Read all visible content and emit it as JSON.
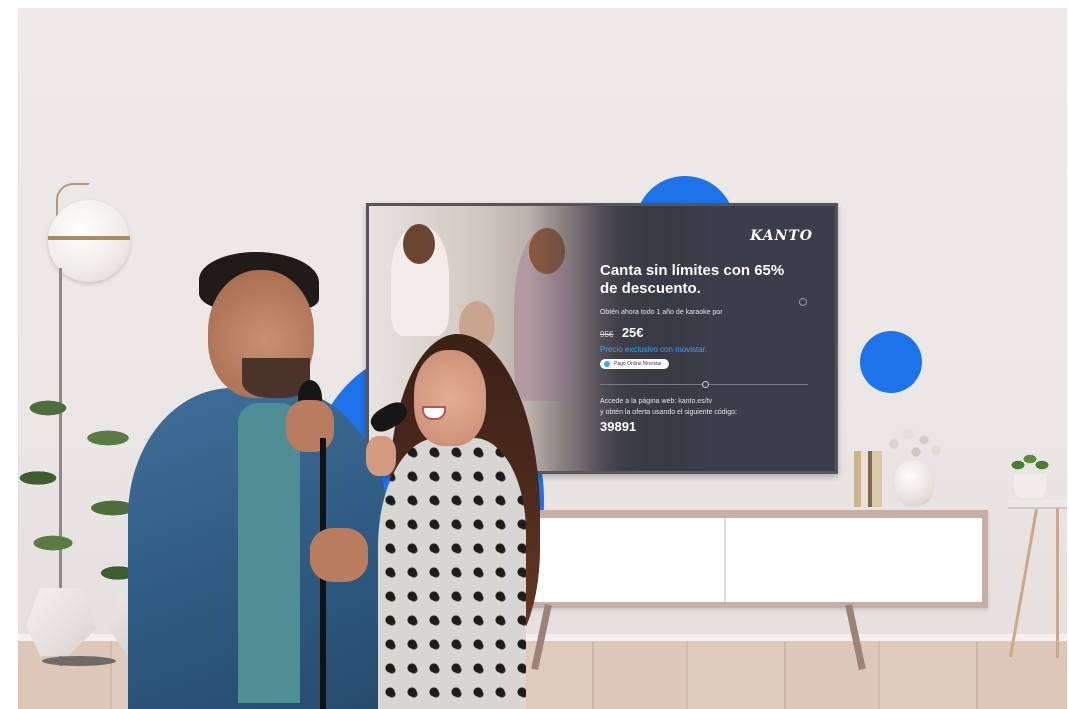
{
  "tv": {
    "logo": "KANTO",
    "headline": "Canta sin límites con 65% de descuento.",
    "offer": "Obtén ahora todo 1 año de karaoke por",
    "old_price": "95€",
    "new_price": "25€",
    "exclusive": "Precio exclusivo con movistar.",
    "pill": "Pago Online Movistar",
    "access_line1": "Accede a la página web: kanto.es/tv",
    "access_line2": "y obtén la oferta usando el siguiente código:",
    "code": "39891"
  },
  "colors": {
    "brand_blue": "#1c73ea",
    "tv_panel": "#3c3d4a",
    "exclusive_text": "#36a7f5",
    "wall": "#eeeaea"
  },
  "icons": {
    "pill": "check-badge-icon"
  }
}
